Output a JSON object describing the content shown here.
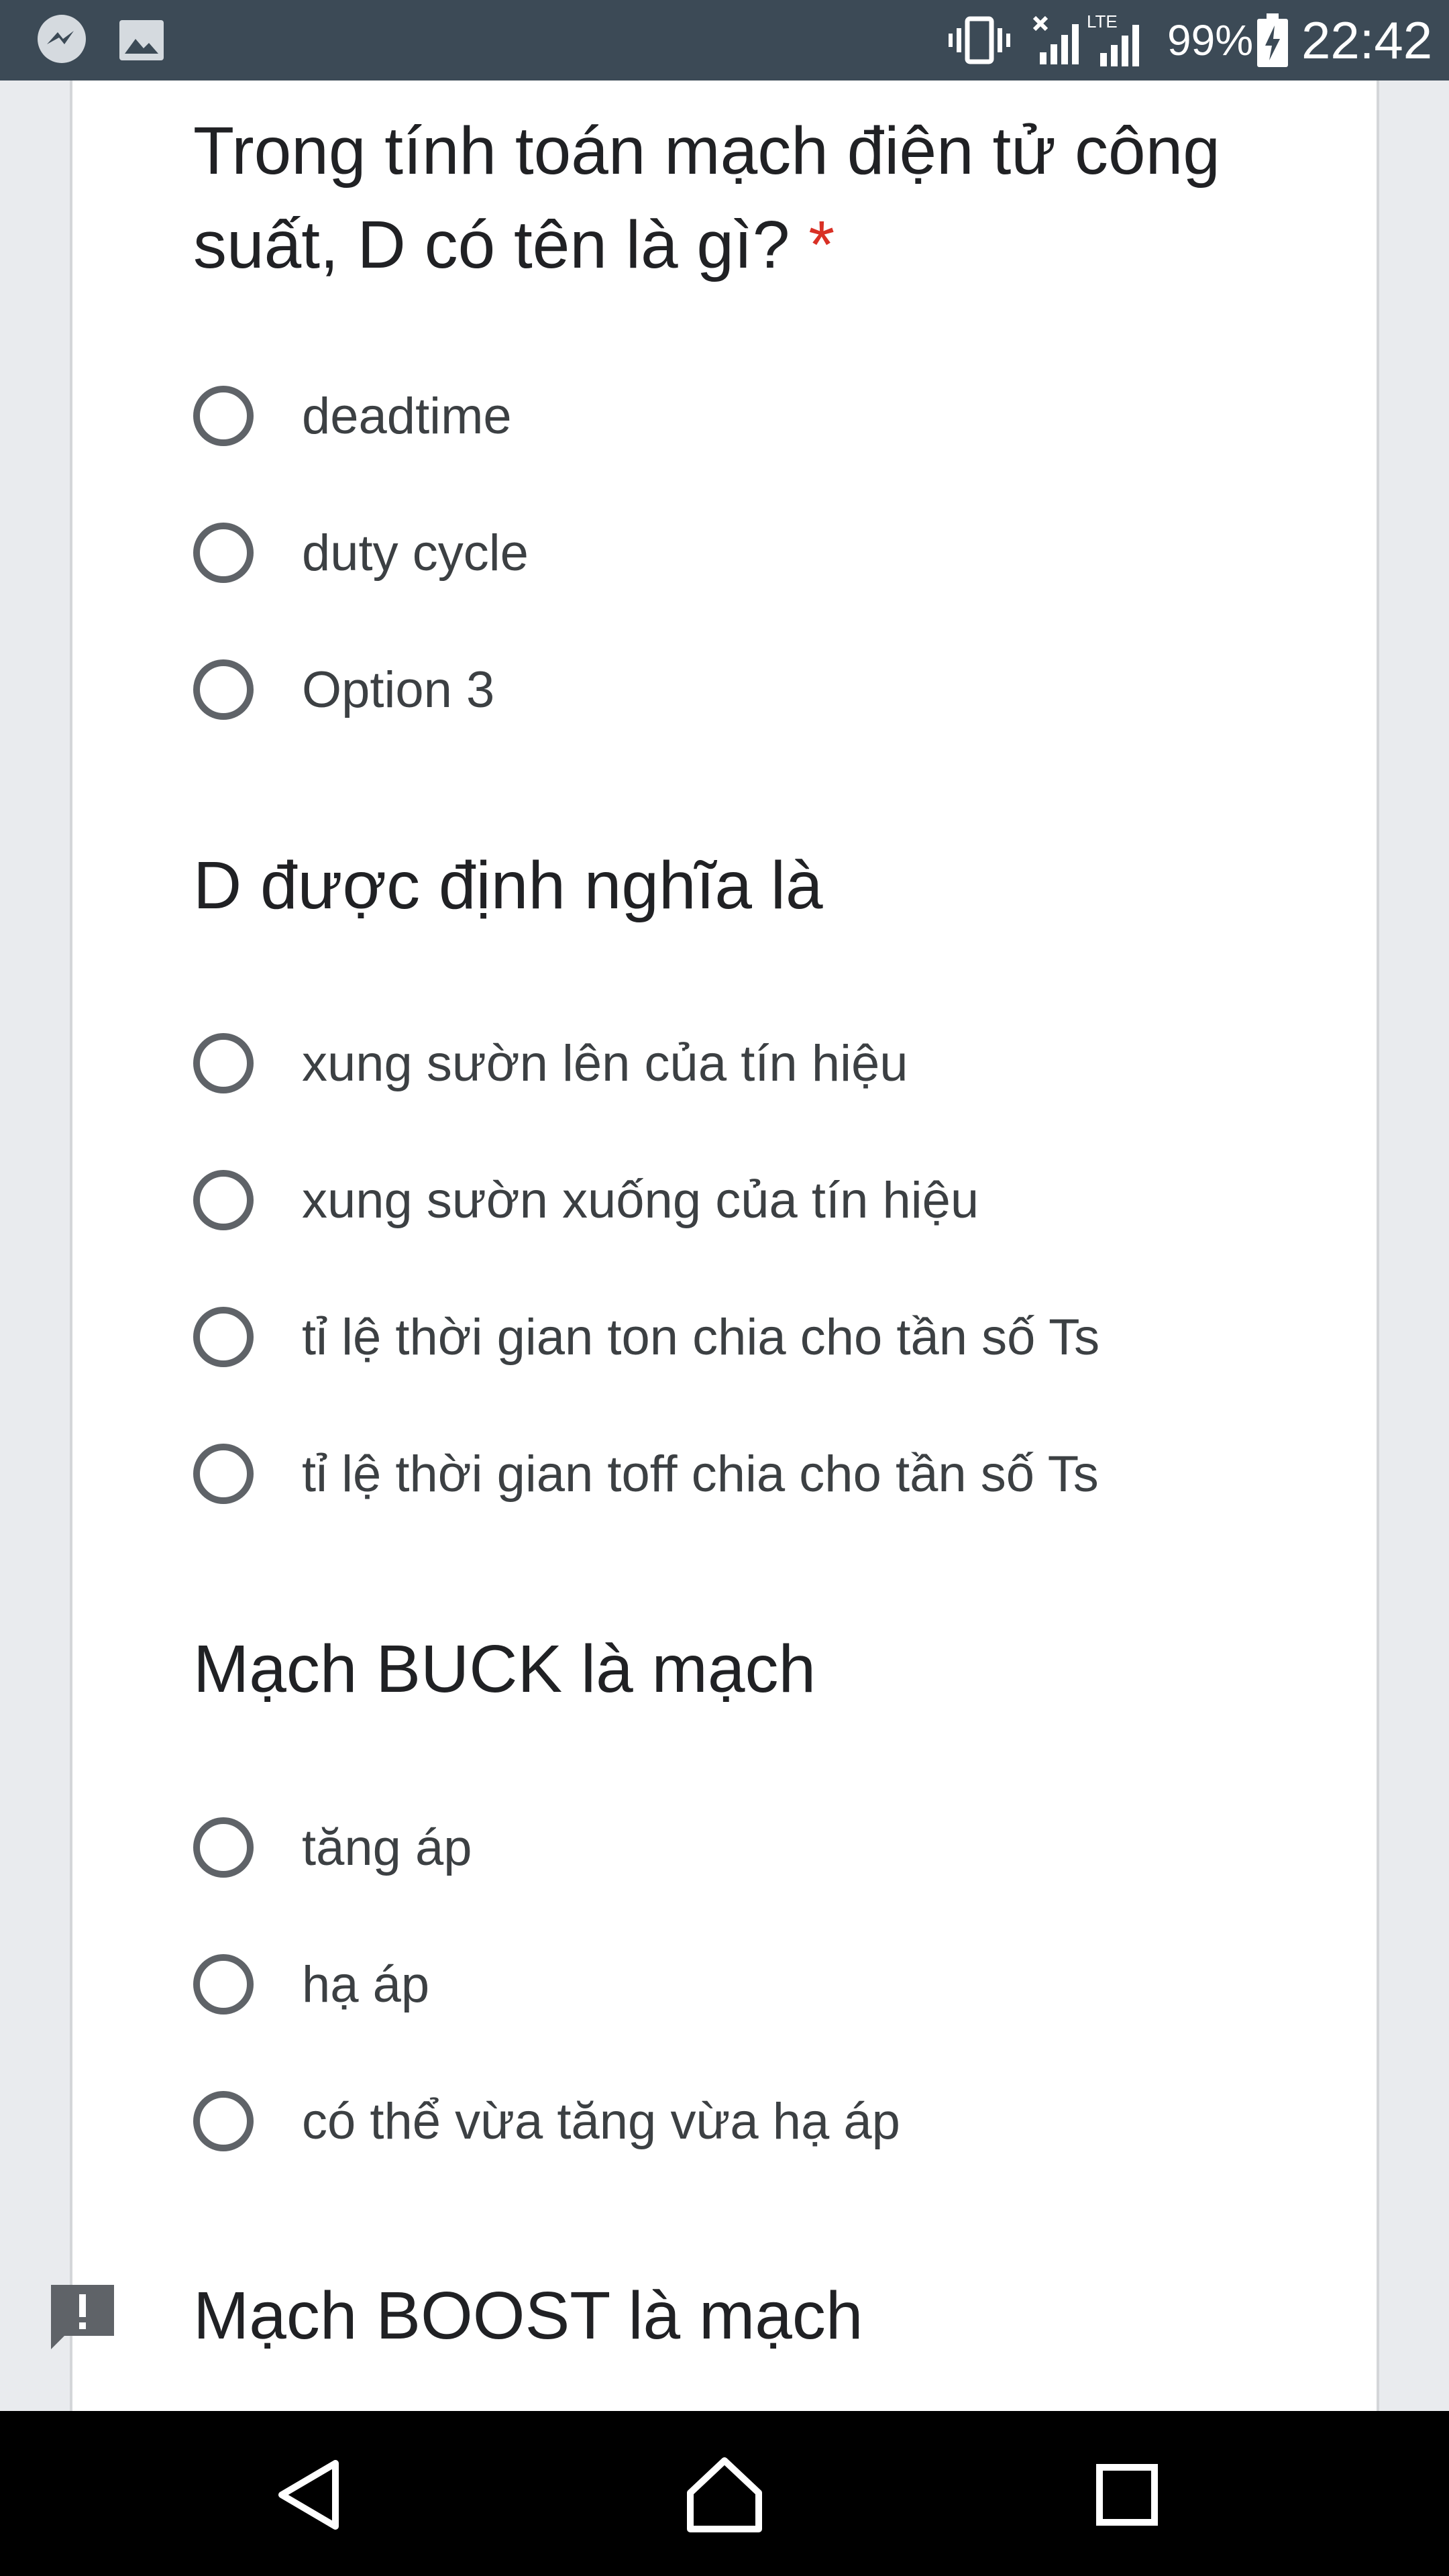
{
  "status_bar": {
    "battery_percent": "99%",
    "time": "22:42",
    "left_icons": [
      "messenger-icon",
      "image-icon"
    ],
    "right_icons": [
      "vibrate-icon",
      "signal-x-icon",
      "lte-signal-icon",
      "battery-charging-icon"
    ],
    "network_label": "LTE"
  },
  "questions": [
    {
      "title": "Trong tính toán mạch điện tử công suất, D có tên là gì?",
      "required_mark": "*",
      "options": [
        "deadtime",
        "duty cycle",
        "Option 3"
      ]
    },
    {
      "title": "D được định nghĩa là",
      "options": [
        "xung sườn lên của tín hiệu",
        "xung sườn xuống của tín hiệu",
        "tỉ lệ thời gian ton chia cho tần số Ts",
        "tỉ lệ thời gian toff chia cho tần số Ts"
      ]
    },
    {
      "title": "Mạch BUCK là mạch",
      "options": [
        "tăng áp",
        "hạ áp",
        "có thể vừa tăng vừa hạ áp"
      ]
    },
    {
      "title": "Mạch BOOST là mạch"
    }
  ],
  "nav_bar": {
    "buttons": [
      "back-icon",
      "home-icon",
      "recents-icon"
    ]
  },
  "colors": {
    "status_bar": "#3c4a56",
    "required": "#d93025",
    "radio_border": "#5f6368",
    "title_text": "#202124",
    "option_text": "#3c4043"
  }
}
